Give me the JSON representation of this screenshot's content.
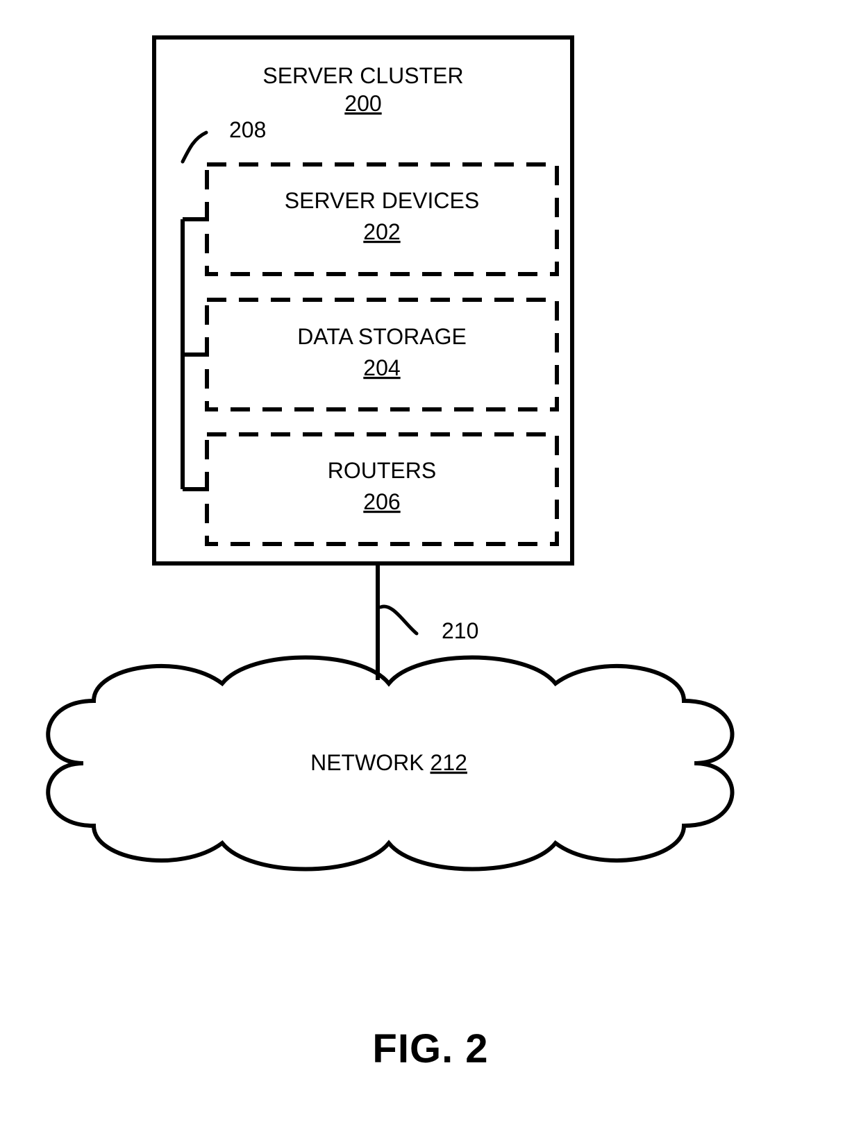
{
  "figure_caption": "FIG. 2",
  "cluster": {
    "title": "SERVER CLUSTER",
    "ref": "200",
    "nodes": [
      {
        "title": "SERVER DEVICES",
        "ref": "202"
      },
      {
        "title": "DATA STORAGE",
        "ref": "204"
      },
      {
        "title": "ROUTERS",
        "ref": "206"
      }
    ]
  },
  "lead_refs": {
    "bracket": "208",
    "link": "210"
  },
  "cloud": {
    "title": "NETWORK",
    "ref": "212"
  }
}
